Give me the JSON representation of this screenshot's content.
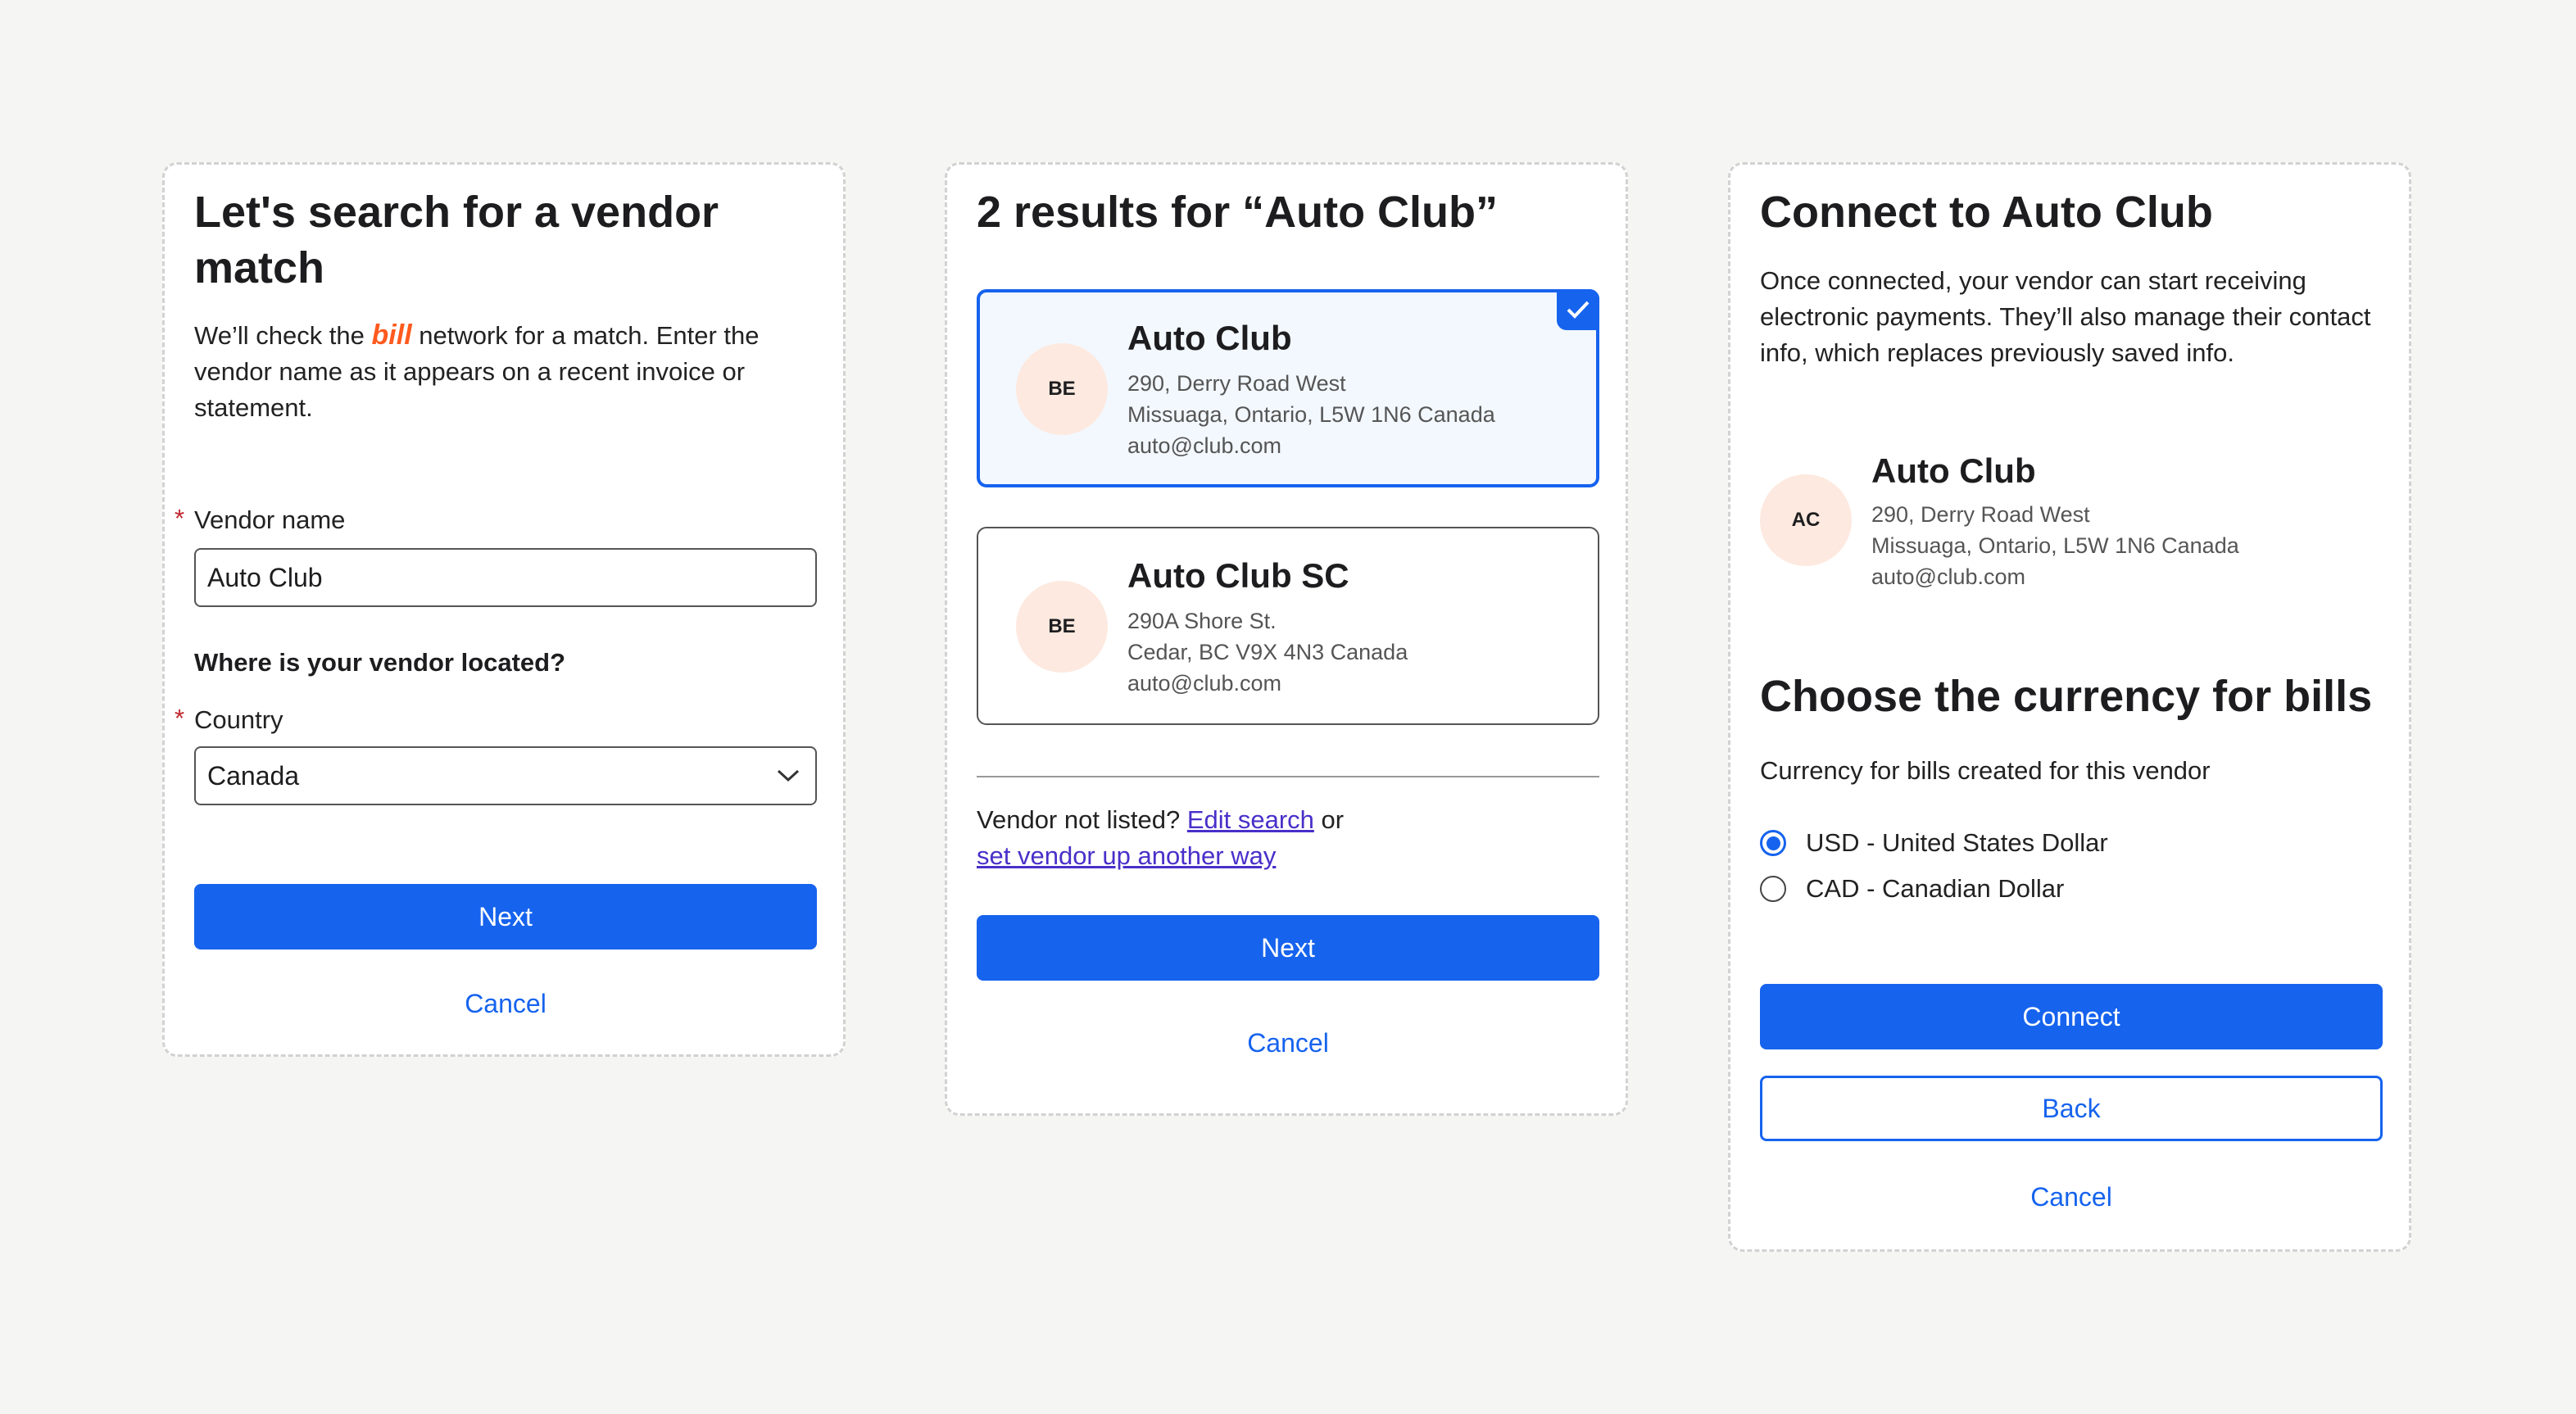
{
  "screen1": {
    "title": "Let's search for a vendor match",
    "desc_prefix": "We’ll check the",
    "brand": "bill",
    "desc_suffix": "network for a match. Enter the vendor name as it appears on a recent invoice or statement.",
    "required_marker": "*",
    "vendor_name_label": "Vendor name",
    "vendor_name_value": "Auto Club",
    "location_question": "Where is your vendor located?",
    "country_label": "Country",
    "country_value": "Canada",
    "next_label": "Next",
    "cancel_label": "Cancel"
  },
  "screen2": {
    "title": "2 results for “Auto Club”",
    "results": [
      {
        "initials": "BE",
        "name": "Auto Club",
        "address1": "290, Derry Road West",
        "address2": "Missuaga, Ontario, L5W 1N6 Canada",
        "email": "auto@club.com",
        "selected": true
      },
      {
        "initials": "BE",
        "name": "Auto Club SC",
        "address1": "290A Shore St.",
        "address2": "Cedar, BC V9X 4N3 Canada",
        "email": "auto@club.com",
        "selected": false
      }
    ],
    "not_listed_text": "Vendor not listed?",
    "edit_search_link": "Edit search",
    "or_text": "or",
    "setup_other_link": "set vendor up another way",
    "next_label": "Next",
    "cancel_label": "Cancel"
  },
  "screen3": {
    "title": "Connect to Auto Club",
    "description": "Once connected, your vendor can start receiving electronic payments. They’ll also manage their contact info, which replaces previously saved info.",
    "vendor": {
      "initials": "AC",
      "name": "Auto Club",
      "address1": "290, Derry Road West",
      "address2": "Missuaga, Ontario, L5W 1N6 Canada",
      "email": "auto@club.com"
    },
    "currency_heading": "Choose the currency for bills",
    "currency_subtext": "Currency for bills created for this vendor",
    "currency_options": [
      {
        "label": "USD - United States Dollar",
        "selected": true
      },
      {
        "label": "CAD - Canadian Dollar",
        "selected": false
      }
    ],
    "connect_label": "Connect",
    "back_label": "Back",
    "cancel_label": "Cancel"
  },
  "colors": {
    "primary": "#1663ee",
    "brand_orange": "#ff5a1f",
    "avatar_bg": "#fde9df",
    "required": "#c0262d",
    "link": "#4830c9"
  }
}
